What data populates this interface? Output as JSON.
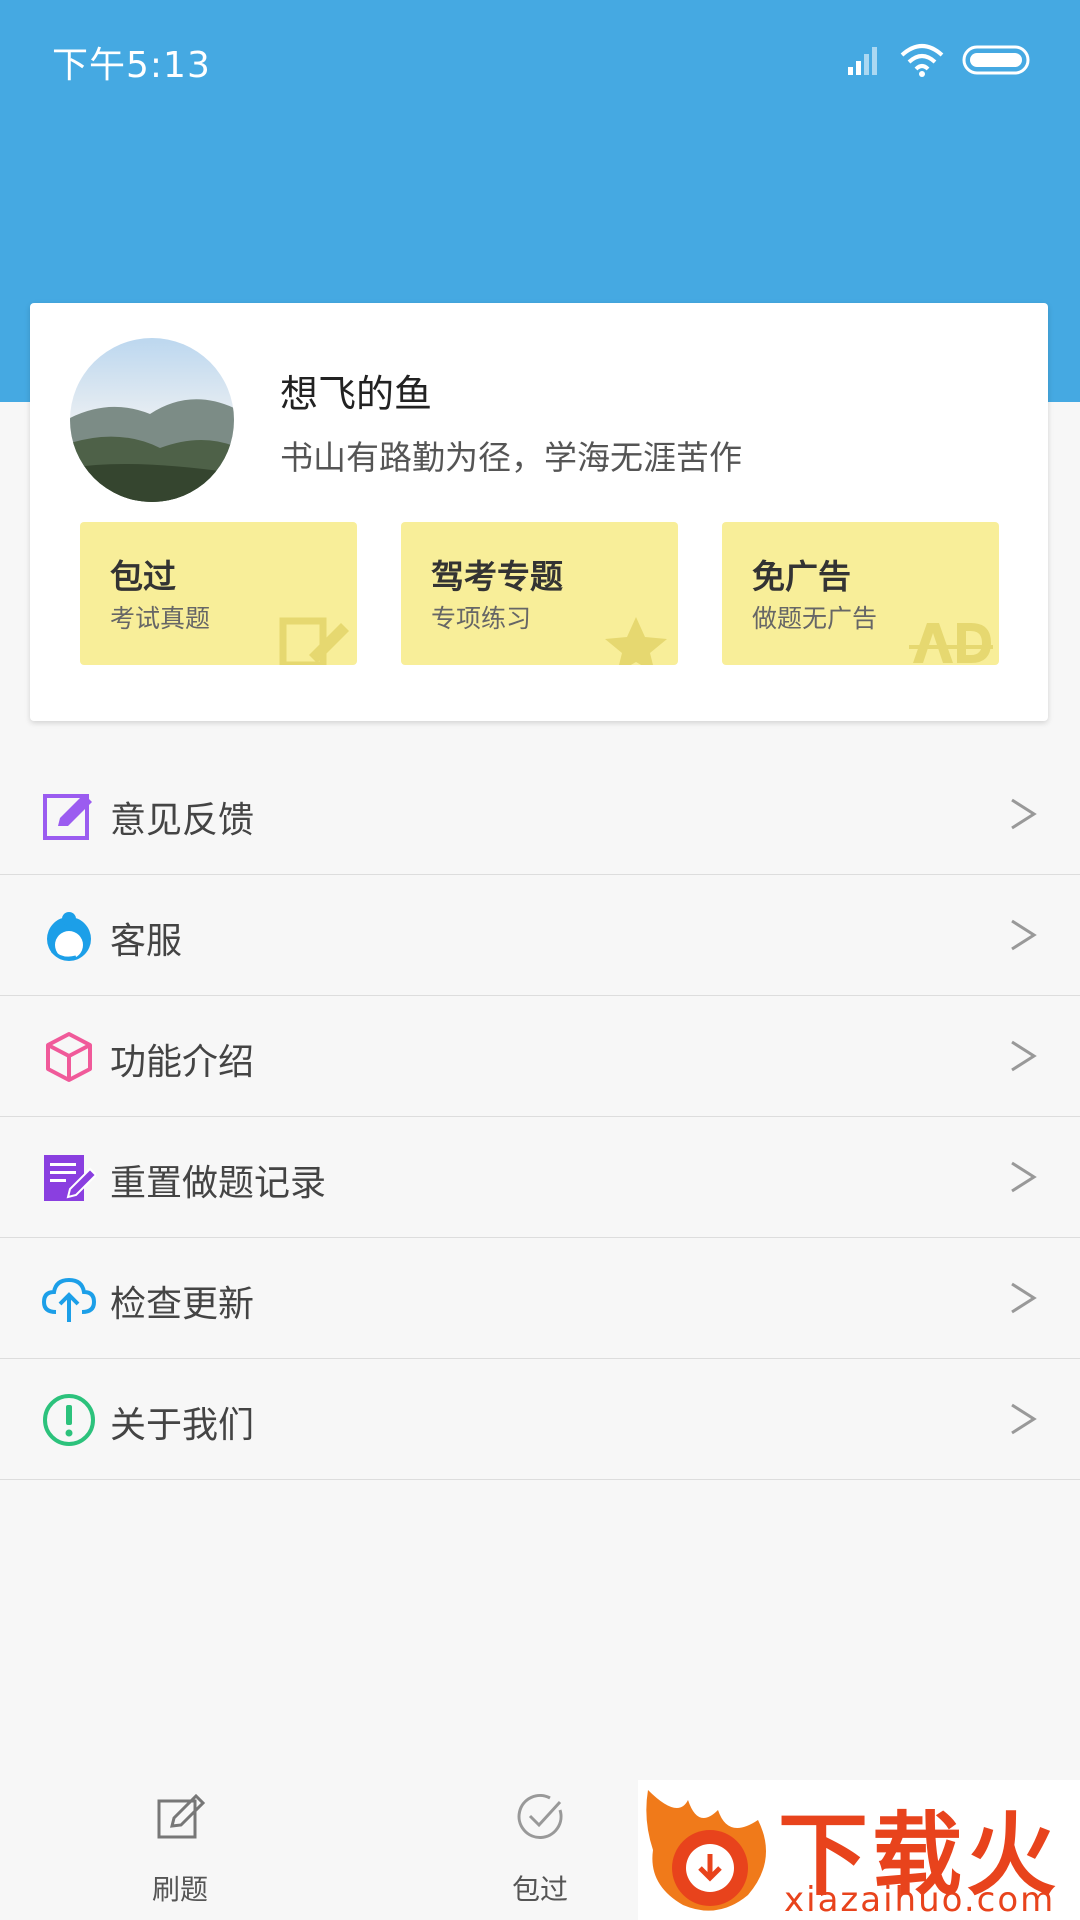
{
  "status_bar": {
    "time": "下午5:13"
  },
  "profile": {
    "name": "想飞的鱼",
    "motto": "书山有路勤为径，学海无涯苦作"
  },
  "features": [
    {
      "title": "包过",
      "subtitle": "考试真题",
      "icon": "edit-icon"
    },
    {
      "title": "驾考专题",
      "subtitle": "专项练习",
      "icon": "star-icon"
    },
    {
      "title": "免广告",
      "subtitle": "做题无广告",
      "icon": "ad-icon"
    }
  ],
  "menu": [
    {
      "label": "意见反馈",
      "icon": "feedback-icon",
      "color": "#9b5cf0"
    },
    {
      "label": "客服",
      "icon": "customer-service-icon",
      "color": "#1c9fe8"
    },
    {
      "label": "功能介绍",
      "icon": "cube-icon",
      "color": "#f05a9a"
    },
    {
      "label": "重置做题记录",
      "icon": "reset-records-icon",
      "color": "#8a3fe0"
    },
    {
      "label": "检查更新",
      "icon": "cloud-upload-icon",
      "color": "#1c9fe8"
    },
    {
      "label": "关于我们",
      "icon": "info-icon",
      "color": "#2cc27c"
    }
  ],
  "menu_arrow": ">",
  "tabs": [
    {
      "label": "刷题",
      "icon": "edit-icon"
    },
    {
      "label": "包过",
      "icon": "check-circle-icon"
    }
  ],
  "watermark": {
    "brand": "下载火",
    "url": "xiazaihuo.com"
  },
  "colors": {
    "header": "#45a9e2",
    "feature_bg": "#f8ee99"
  }
}
